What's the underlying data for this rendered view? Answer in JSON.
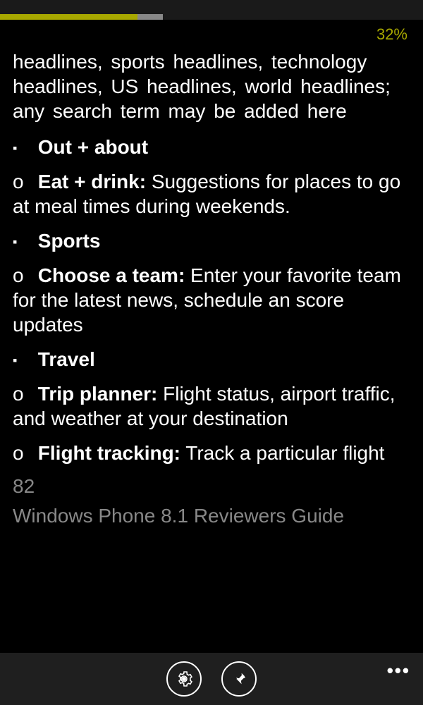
{
  "percent": "32%",
  "intro": "headlines,  sports  headlines, technology  headlines,  US headlines, world headlines; any search term may be added here",
  "sections": {
    "out_about": {
      "heading": "Out + about"
    },
    "eat_drink": {
      "label": "Eat + drink:",
      "text": " Suggestions for places to go at meal times during weekends."
    },
    "sports": {
      "heading": "Sports"
    },
    "choose_team": {
      "label": "Choose  a  team:",
      "text": " Enter  your favorite  team  for  the  latest  news, schedule  an  score updates"
    },
    "travel": {
      "heading": "Travel"
    },
    "trip_planner": {
      "label": "Trip planner:",
      "text": " Flight status, airport traffic, and weather at your destination"
    },
    "flight_tracking": {
      "label": "Flight tracking:",
      "text": " Track a particular flight"
    }
  },
  "page_number": "82",
  "doc_title": "Windows Phone 8.1 Reviewers Guide",
  "appbar": {
    "settings": "settings",
    "pin": "pin",
    "more": "•••"
  }
}
